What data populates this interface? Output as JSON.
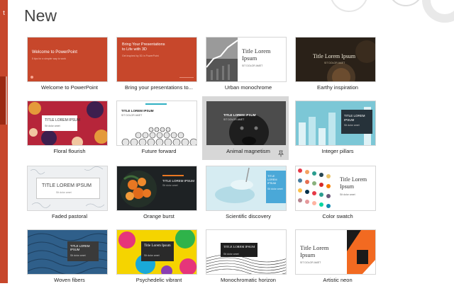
{
  "sidebar": {
    "glyph": "t"
  },
  "header": {
    "title": "New"
  },
  "templates": [
    {
      "label": "Welcome to PowerPoint",
      "thumb_title": "Welcome to PowerPoint",
      "thumb_sub": "5 tips for a simpler way to work"
    },
    {
      "label": "Bring your presentations to...",
      "thumb_title": "Bring Your Presentations to Life with 3D",
      "thumb_sub": "Get inspired by 3D in PowerPoint"
    },
    {
      "label": "Urban monochrome",
      "thumb_title": "Title Lorem Ipsum",
      "thumb_sub": "SIT DOLOR AMET"
    },
    {
      "label": "Earthy inspiration",
      "thumb_title": "Title Lorem Ipsum",
      "thumb_sub": "SIT DOLOR AMET"
    },
    {
      "label": "Floral flourish",
      "thumb_title": "TITLE LOREM IPSUM",
      "thumb_sub": "Sit dolor amet"
    },
    {
      "label": "Future forward",
      "thumb_title": "TITLE LOREM IPSUM",
      "thumb_sub": "SIT DOLOR AMET"
    },
    {
      "label": "Animal magnetism",
      "thumb_title": "TITLE LOREM IPSUM",
      "thumb_sub": "SIT DOLOR AMET"
    },
    {
      "label": "Integer pillars",
      "thumb_title": "TITLE LOREM IPSUM",
      "thumb_sub": "Sit dolor amet"
    },
    {
      "label": "Faded pastoral",
      "thumb_title": "TITLE LOREM IPSUM",
      "thumb_sub": "Sit dolor amet"
    },
    {
      "label": "Orange burst",
      "thumb_title": "TITLE LOREM IPSUM",
      "thumb_sub": "Sit dolor amet"
    },
    {
      "label": "Scientific discovery",
      "thumb_title": "TITLE LOREM IPSUM",
      "thumb_sub": "Sit dolor amet"
    },
    {
      "label": "Color swatch",
      "thumb_title": "Title Lorem Ipsum",
      "thumb_sub": "Sit dolor amet"
    },
    {
      "label": "Woven fibers",
      "thumb_title": "TITLE LOREM IPSUM",
      "thumb_sub": "Sit dolor amet"
    },
    {
      "label": "Psychedelic vibrant",
      "thumb_title": "Title Lorem Ipsum",
      "thumb_sub": "Sit dolor amet"
    },
    {
      "label": "Monochromatic horizon",
      "thumb_title": "TITLE LOREM IPSUM",
      "thumb_sub": "Sit dolor amet"
    },
    {
      "label": "Artistic neon",
      "thumb_title": "Title Lorem Ipsum",
      "thumb_sub": "SIT DOLOR AMET"
    }
  ],
  "colors": {
    "brand": "#c7472b",
    "brand_dark": "#9b2a13",
    "selected_bg": "#d7d7d7"
  }
}
